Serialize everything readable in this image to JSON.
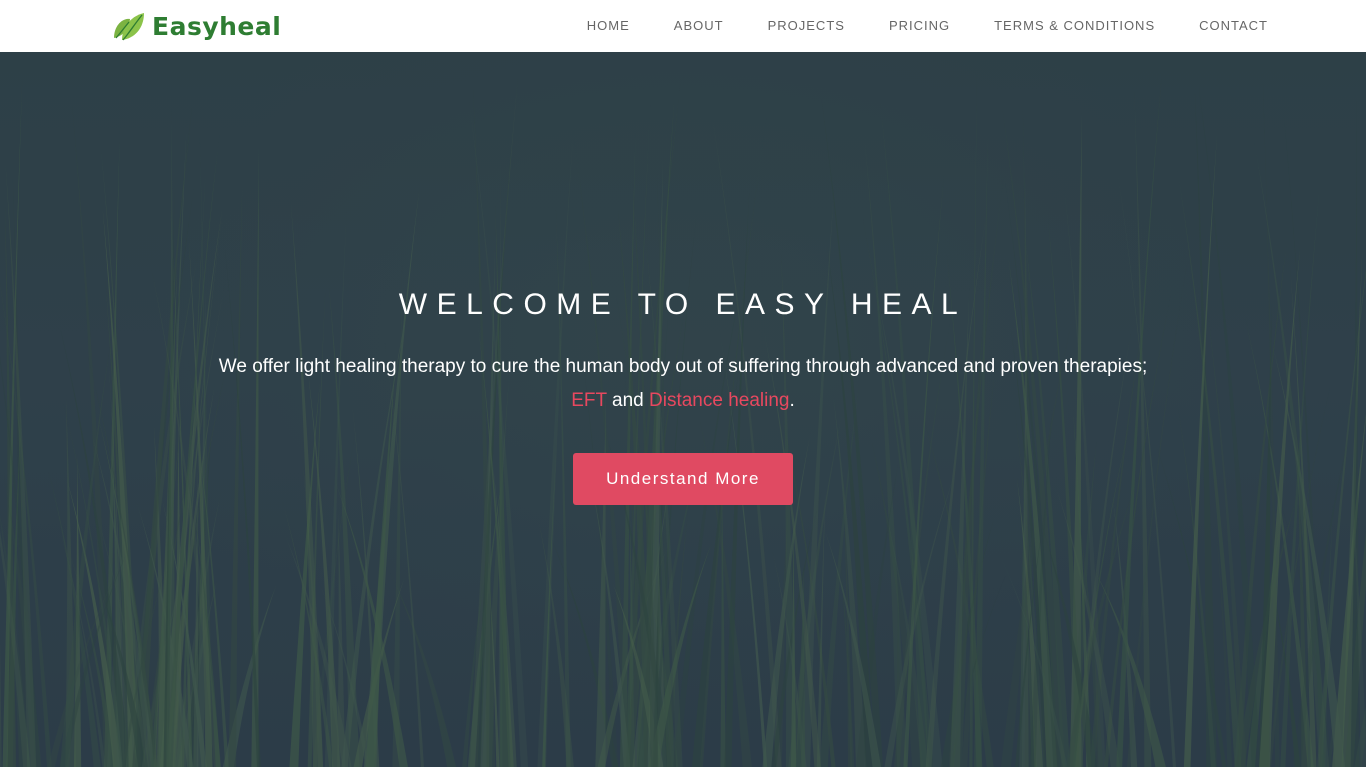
{
  "brand": {
    "name": "Easyheal",
    "icon": "leaf-icon",
    "color": "#2e7d32"
  },
  "nav": {
    "items": [
      {
        "label": "HOME"
      },
      {
        "label": "ABOUT"
      },
      {
        "label": "PROJECTS"
      },
      {
        "label": "PRICING"
      },
      {
        "label": "TERMS & CONDITIONS"
      },
      {
        "label": "CONTACT"
      }
    ]
  },
  "hero": {
    "title": "WELCOME TO EASY HEAL",
    "text_before": "We offer light healing therapy to cure the human body out of suffering through advanced and proven therapies; ",
    "link_eft": "EFT",
    "text_and": " and ",
    "link_distance": "Distance healing",
    "text_end": ".",
    "cta_label": "Understand More"
  },
  "colors": {
    "accent": "#e04a62",
    "link": "#e8485f",
    "nav_text": "#666666"
  }
}
